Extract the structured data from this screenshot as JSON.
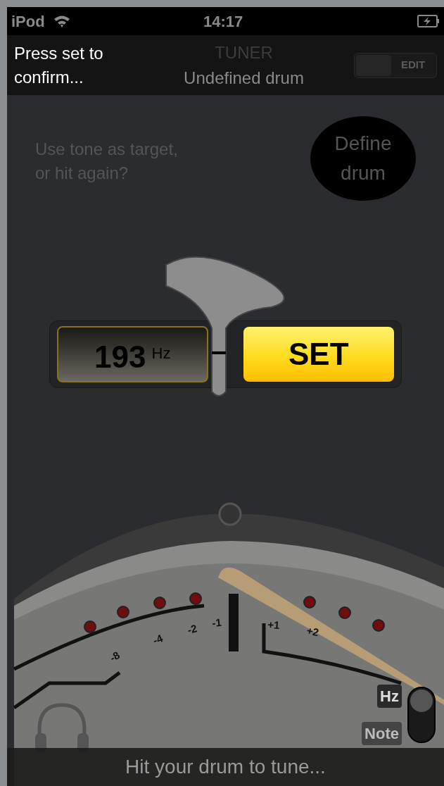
{
  "status_bar": {
    "device": "iPod",
    "time": "14:17"
  },
  "header": {
    "prompt": "Press set to confirm...",
    "title": "TUNER",
    "subtitle": "Undefined drum",
    "edit_toggle": {
      "label": "EDIT",
      "on": false
    }
  },
  "question": "Use tone as target, or hit again?",
  "define_button": "Define drum",
  "reading": {
    "value": "193",
    "unit": "Hz"
  },
  "set_button": "SET",
  "gauge": {
    "left_labels": [
      "-8",
      "-4",
      "-2",
      "-1"
    ],
    "right_labels": [
      "+1",
      "+2"
    ]
  },
  "unit_switch": [
    {
      "label": "Hz",
      "selected": true
    },
    {
      "label": "Note",
      "selected": false
    }
  ],
  "hint": "Hit your drum to tune..."
}
